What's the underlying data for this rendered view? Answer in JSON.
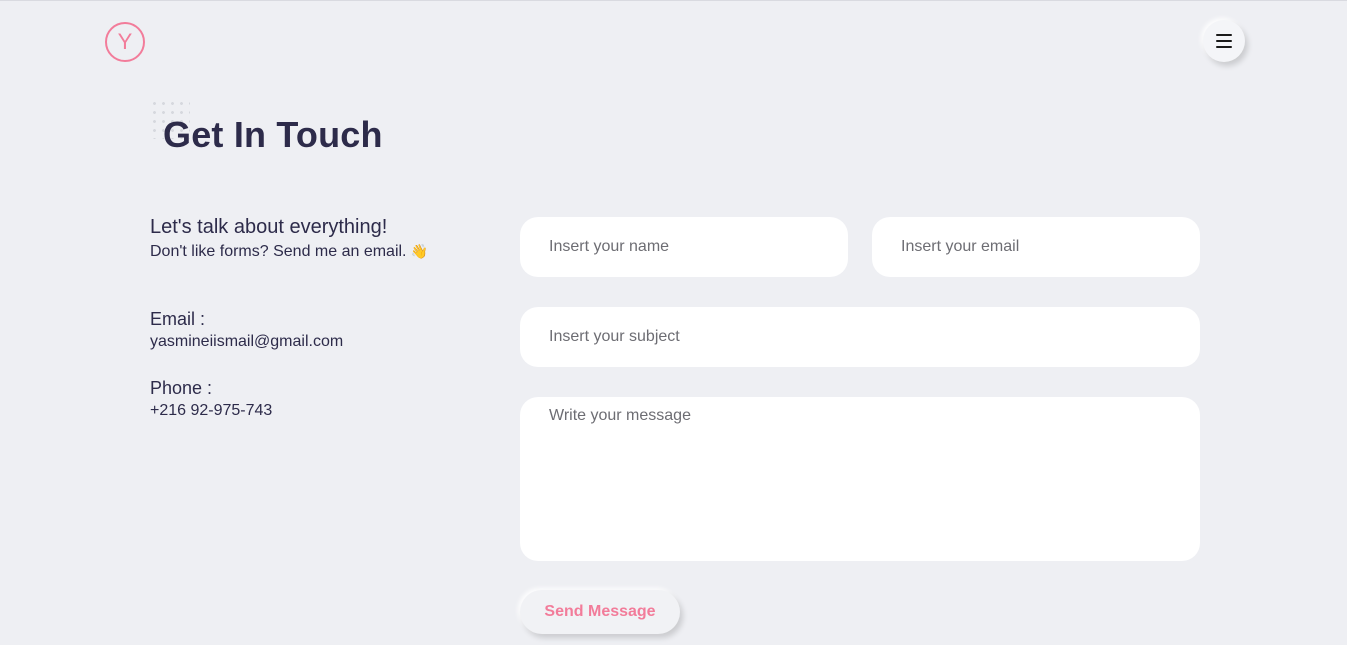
{
  "header": {
    "logo_letter": "Y",
    "menu_icon": "hamburger-icon"
  },
  "page": {
    "title": "Get In Touch"
  },
  "contact_info": {
    "heading": "Let's talk about everything!",
    "subheading": "Don't like forms? Send me an email.",
    "wave_emoji": "👋",
    "email_label": "Email :",
    "email_value": "yasmineiismail@gmail.com",
    "phone_label": "Phone :",
    "phone_value": "+216 92-975-743"
  },
  "form": {
    "name_placeholder": "Insert your name",
    "email_placeholder": "Insert your email",
    "subject_placeholder": "Insert your subject",
    "message_placeholder": "Write your message",
    "submit_label": "Send Message"
  },
  "colors": {
    "accent": "#f27c9a",
    "background": "#eeeff3",
    "text": "#2d2b4a"
  }
}
